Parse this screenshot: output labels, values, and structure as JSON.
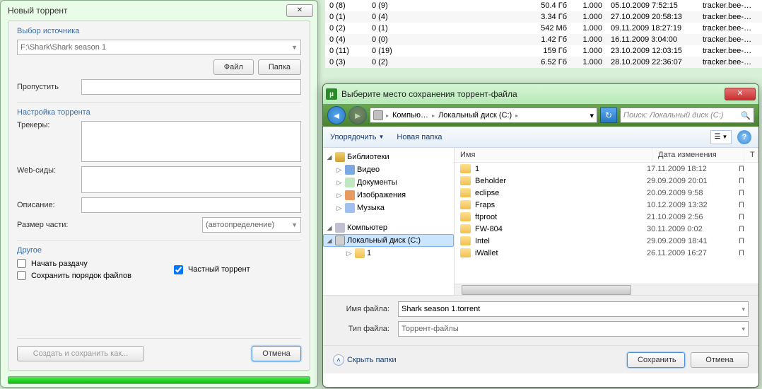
{
  "bg_table": {
    "rows": [
      {
        "c1": "0 (8)",
        "c2": "0 (9)",
        "size": "50.4 Гб",
        "ratio": "1.000",
        "added": "05.10.2009 7:52:15",
        "tracker": "tracker.bee-…"
      },
      {
        "c1": "0 (1)",
        "c2": "0 (4)",
        "size": "3.34 Гб",
        "ratio": "1.000",
        "added": "27.10.2009 20:58:13",
        "tracker": "tracker.bee-…"
      },
      {
        "c1": "0 (2)",
        "c2": "0 (1)",
        "size": "542 Мб",
        "ratio": "1.000",
        "added": "09.11.2009 18:27:19",
        "tracker": "tracker.bee-…"
      },
      {
        "c1": "0 (4)",
        "c2": "0 (0)",
        "size": "1.42 Гб",
        "ratio": "1.000",
        "added": "16.11.2009 3:04:00",
        "tracker": "tracker.bee-…"
      },
      {
        "c1": "0 (11)",
        "c2": "0 (19)",
        "size": "159 Гб",
        "ratio": "1.000",
        "added": "23.10.2009 12:03:15",
        "tracker": "tracker.bee-…"
      },
      {
        "c1": "0 (3)",
        "c2": "0 (2)",
        "size": "6.52 Гб",
        "ratio": "1.000",
        "added": "28.10.2009 22:36:07",
        "tracker": "tracker.bee-…"
      }
    ]
  },
  "new_torrent": {
    "title": "Новый торрент",
    "source_section": "Выбор источника",
    "source_path": "F:\\Shark\\Shark season 1",
    "file_btn": "Файл",
    "folder_btn": "Папка",
    "skip_label": "Пропустить",
    "settings_section": "Настройка торрента",
    "trackers_label": "Трекеры:",
    "webseeds_label": "Web-сиды:",
    "desc_label": "Описание:",
    "piece_label": "Размер части:",
    "piece_value": "(автоопределение)",
    "other_section": "Другое",
    "start_seeding": "Начать раздачу",
    "private_torrent": "Частный торрент",
    "preserve_order": "Сохранить порядок файлов",
    "create_btn": "Создать и сохранить как...",
    "cancel_btn": "Отмена"
  },
  "save_dialog": {
    "title": "Выберите место сохранения торрент-файла",
    "crumbs": [
      "Компью…",
      "Локальный диск (C:)"
    ],
    "search_placeholder": "Поиск: Локальный диск (C:)",
    "organize": "Упорядочить",
    "new_folder": "Новая папка",
    "tree": {
      "libraries": "Библиотеки",
      "video": "Видео",
      "documents": "Документы",
      "images": "Изображения",
      "music": "Музыка",
      "computer": "Компьютер",
      "local_c": "Локальный диск (C:)",
      "one": "1"
    },
    "cols": {
      "name": "Имя",
      "modified": "Дата изменения",
      "type": "Т"
    },
    "files": [
      {
        "name": "1",
        "date": "17.11.2009 18:12",
        "type": "П"
      },
      {
        "name": "Beholder",
        "date": "29.09.2009 20:01",
        "type": "П"
      },
      {
        "name": "eclipse",
        "date": "20.09.2009 9:58",
        "type": "П"
      },
      {
        "name": "Fraps",
        "date": "10.12.2009 13:32",
        "type": "П"
      },
      {
        "name": "ftproot",
        "date": "21.10.2009 2:56",
        "type": "П"
      },
      {
        "name": "FW-804",
        "date": "30.11.2009 0:02",
        "type": "П"
      },
      {
        "name": "Intel",
        "date": "29.09.2009 18:41",
        "type": "П"
      },
      {
        "name": "iWallet",
        "date": "26.11.2009 16:27",
        "type": "П"
      }
    ],
    "filename_label": "Имя файла:",
    "filename_value": "Shark season 1.torrent",
    "filetype_label": "Тип файла:",
    "filetype_value": "Торрент-файлы",
    "hide_folders": "Скрыть папки",
    "save_btn": "Сохранить",
    "cancel_btn": "Отмена"
  }
}
